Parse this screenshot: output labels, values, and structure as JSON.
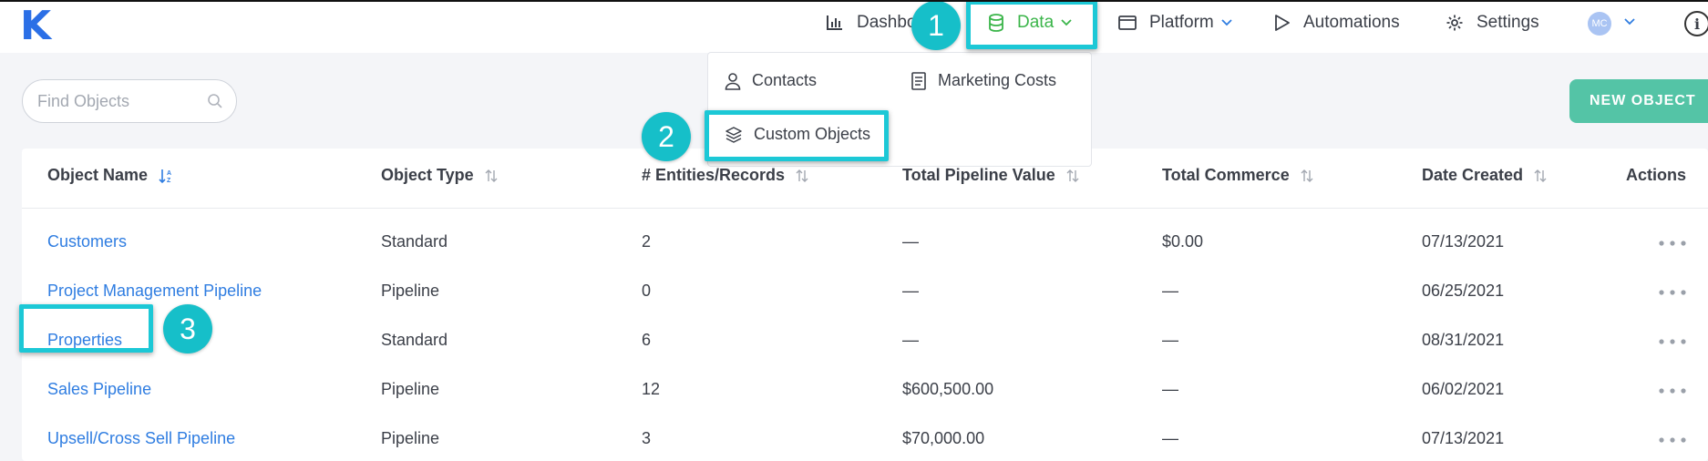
{
  "app": {
    "logo": "K"
  },
  "nav": {
    "dashboard": "Dashboards",
    "data": "Data",
    "platform": "Platform",
    "automations": "Automations",
    "settings": "Settings",
    "avatar_initials": "MC",
    "info": "i"
  },
  "dropdown": {
    "contacts": "Contacts",
    "marketing_costs": "Marketing Costs",
    "custom_objects": "Custom Objects"
  },
  "search": {
    "placeholder": "Find Objects"
  },
  "new_object_label": "NEW OBJECT",
  "table": {
    "headers": {
      "name": "Object Name",
      "type": "Object Type",
      "entities": "# Entities/Records",
      "pipeline_value": "Total Pipeline Value",
      "commerce": "Total Commerce",
      "date": "Date Created",
      "actions": "Actions"
    },
    "rows": [
      {
        "name": "Customers",
        "type": "Standard",
        "entities": "2",
        "pipeline_value": "—",
        "commerce": "$0.00",
        "date": "07/13/2021"
      },
      {
        "name": "Project Management Pipeline",
        "type": "Pipeline",
        "entities": "0",
        "pipeline_value": "—",
        "commerce": "—",
        "date": "06/25/2021"
      },
      {
        "name": "Properties",
        "type": "Standard",
        "entities": "6",
        "pipeline_value": "—",
        "commerce": "—",
        "date": "08/31/2021"
      },
      {
        "name": "Sales Pipeline",
        "type": "Pipeline",
        "entities": "12",
        "pipeline_value": "$600,500.00",
        "commerce": "—",
        "date": "06/02/2021"
      },
      {
        "name": "Upsell/Cross Sell Pipeline",
        "type": "Pipeline",
        "entities": "3",
        "pipeline_value": "$70,000.00",
        "commerce": "—",
        "date": "07/13/2021"
      }
    ]
  },
  "steps": [
    "1",
    "2",
    "3"
  ],
  "colors": {
    "accent": "#1cc8d6",
    "brand": "#2b6fe6",
    "active_nav": "#3bb54a",
    "link": "#2f7de1",
    "primary_button": "#54c4a6"
  }
}
